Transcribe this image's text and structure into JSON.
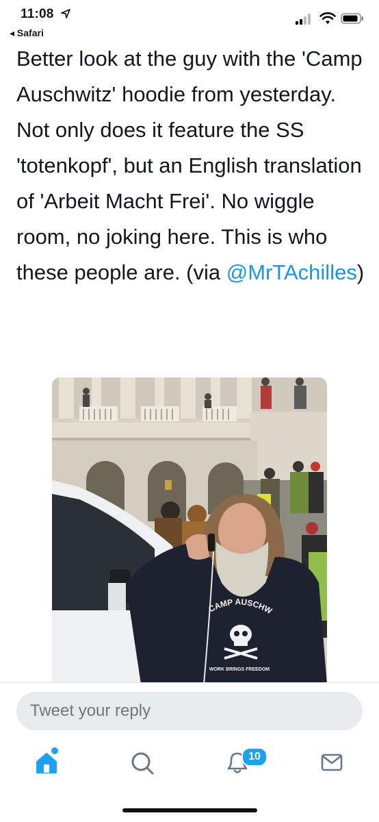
{
  "status_bar": {
    "time": "11:08",
    "back_app": "◂ Safari"
  },
  "tweet": {
    "text": "Better look at the guy with the 'Camp Auschwitz' hoodie from yesterday. Not only does it feature the SS 'totenkopf', but an English translation of 'Arbeit Macht Frei'. No wiggle room, no joking here. This is who these people are. (via ",
    "mention": "@MrTAchilles",
    "text_end": ")"
  },
  "photo": {
    "hoodie_text_top": "CAMP AUSCHWITZ",
    "hoodie_text_bottom": "WORK BRINGS FREEDOM"
  },
  "reply": {
    "placeholder": "Tweet your reply"
  },
  "tab_bar": {
    "items": [
      "home-icon",
      "search-icon",
      "notifications-icon",
      "messages-icon"
    ],
    "notification_count": "10"
  },
  "colors": {
    "accent": "#1da1f2",
    "mention": "#1b95e0",
    "input_bg": "#e8ebee",
    "placeholder": "#657786"
  }
}
